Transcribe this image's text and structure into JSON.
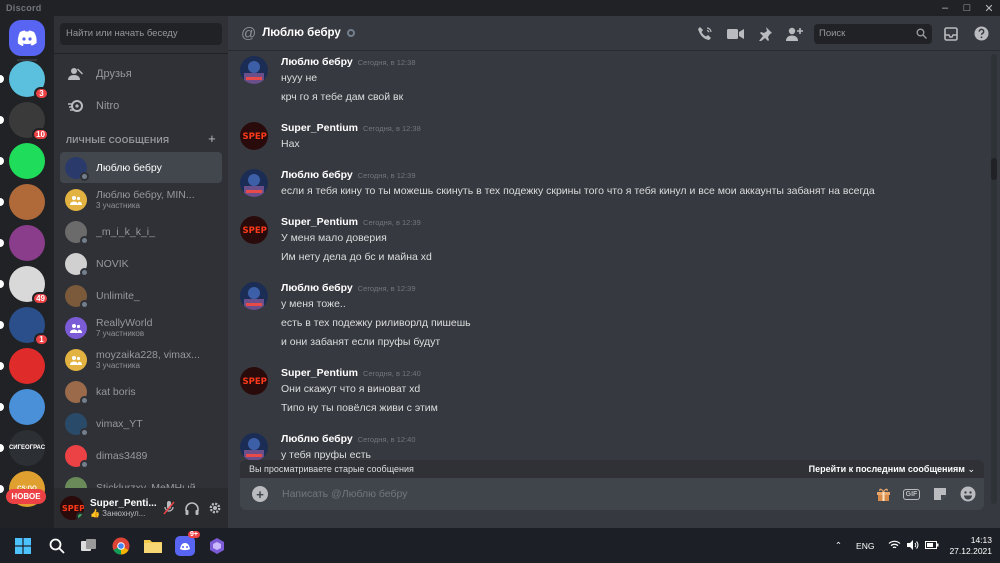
{
  "window": {
    "app_name": "Discord",
    "controls": [
      "minimize",
      "maximize",
      "close"
    ]
  },
  "servers": [
    {
      "name": "home",
      "badge": ""
    },
    {
      "name": "server-1",
      "badge": "3",
      "color": "#5bc0de"
    },
    {
      "name": "server-2",
      "badge": "10",
      "color": "#3a3a3a"
    },
    {
      "name": "server-3",
      "badge": "",
      "color": "#1fdc5a"
    },
    {
      "name": "server-4",
      "badge": "",
      "color": "#b06a3a"
    },
    {
      "name": "server-5",
      "badge": "",
      "color": "#8a3d8a"
    },
    {
      "name": "server-6",
      "badge": "49",
      "color": "#d9d9d9"
    },
    {
      "name": "server-7",
      "badge": "1",
      "color": "#2a4f8a"
    },
    {
      "name": "server-8",
      "badge": "",
      "color": "#e02b2b"
    },
    {
      "name": "server-9",
      "badge": "",
      "color": "#4a90d9"
    },
    {
      "name": "server-10",
      "badge": "",
      "color": "#2c2f33",
      "label": "СИГЕОГРАС"
    },
    {
      "name": "server-11",
      "badge": "",
      "color": "#e0a030",
      "label": "CS:GO"
    }
  ],
  "new_badge": "НОВОЕ",
  "dm_panel": {
    "search_placeholder": "Найти или начать беседу",
    "nav": [
      {
        "label": "Друзья",
        "icon": "friends-icon"
      },
      {
        "label": "Nitro",
        "icon": "nitro-icon"
      }
    ],
    "section_title": "ЛИЧНЫЕ СООБЩЕНИЯ",
    "conversations": [
      {
        "name": "Люблю бебру",
        "sub": "",
        "active": true,
        "color": "#2a3a6a",
        "status": "offline"
      },
      {
        "name": "Люблю бебру, MIN...",
        "sub": "3 участника",
        "active": false,
        "color": "#e3b341",
        "group": true
      },
      {
        "name": "_m_i_k_k_i_",
        "sub": "",
        "active": false,
        "color": "#6b6b6b",
        "status": "offline"
      },
      {
        "name": "NOVIK",
        "sub": "",
        "active": false,
        "color": "#d0d0d0",
        "status": "offline"
      },
      {
        "name": "Unlimite_",
        "sub": "",
        "active": false,
        "color": "#7a5a3a",
        "status": "offline"
      },
      {
        "name": "ReallyWorld",
        "sub": "7 участников",
        "active": false,
        "color": "#7b5bd6",
        "group": true
      },
      {
        "name": "moyzaika228, vimax...",
        "sub": "3 участника",
        "active": false,
        "color": "#e3b341",
        "group": true
      },
      {
        "name": "kat boris",
        "sub": "",
        "active": false,
        "color": "#9a6a4a",
        "status": "offline"
      },
      {
        "name": "vimax_YT",
        "sub": "",
        "active": false,
        "color": "#2a4a6a",
        "status": "offline"
      },
      {
        "name": "dimas3489",
        "sub": "",
        "active": false,
        "color": "#ed4245",
        "status": "offline"
      },
      {
        "name": "Sticklurzxy, MeMHый",
        "sub": "",
        "active": false,
        "color": "#6a8a5a",
        "status": "offline"
      }
    ]
  },
  "user": {
    "name": "Super_Penti...",
    "status": "👍 Занюхнул..."
  },
  "channel": {
    "title": "Люблю бебру",
    "search_placeholder": "Поиск"
  },
  "messages": [
    {
      "author": "Люблю бебру",
      "time": "Сегодня, в 12:38",
      "kind": "a",
      "lines": [
        "нууу не",
        "крч го я тебе дам свой вк"
      ]
    },
    {
      "author": "Super_Pentium",
      "time": "Сегодня, в 12:38",
      "kind": "b",
      "lines": [
        "Нах"
      ]
    },
    {
      "author": "Люблю бебру",
      "time": "Сегодня, в 12:39",
      "kind": "a",
      "lines": [
        "если я тебя кину то ты можешь скинуть в тех подежку скрины того что я тебя кинул и все мои аккаунты забанят на всегда"
      ]
    },
    {
      "author": "Super_Pentium",
      "time": "Сегодня, в 12:39",
      "kind": "b",
      "lines": [
        "У меня мало доверия",
        "Им нету дела до бс и майна xd"
      ]
    },
    {
      "author": "Люблю бебру",
      "time": "Сегодня, в 12:39",
      "kind": "a",
      "lines": [
        "у меня тоже..",
        "есть в тех подежку риливорлд пишешь",
        "и они забанят если пруфы будут"
      ]
    },
    {
      "author": "Super_Pentium",
      "time": "Сегодня, в 12:40",
      "kind": "b",
      "lines": [
        "Они скажут что я виноват xd",
        "Типо ну ты повёлся живи с этим"
      ]
    },
    {
      "author": "Люблю бебру",
      "time": "Сегодня, в 12:40",
      "kind": "a",
      "lines": [
        "у тебя пруфы есть"
      ]
    }
  ],
  "old_messages_bar": {
    "left": "Вы просматриваете старые сообщения",
    "right": "Перейти к последним сообщениям"
  },
  "composer": {
    "placeholder": "Написать @Люблю бебру",
    "gif_label": "GIF"
  },
  "taskbar": {
    "lang": "ENG",
    "time": "14:13",
    "date": "27.12.2021",
    "discord_badge": "9+"
  }
}
